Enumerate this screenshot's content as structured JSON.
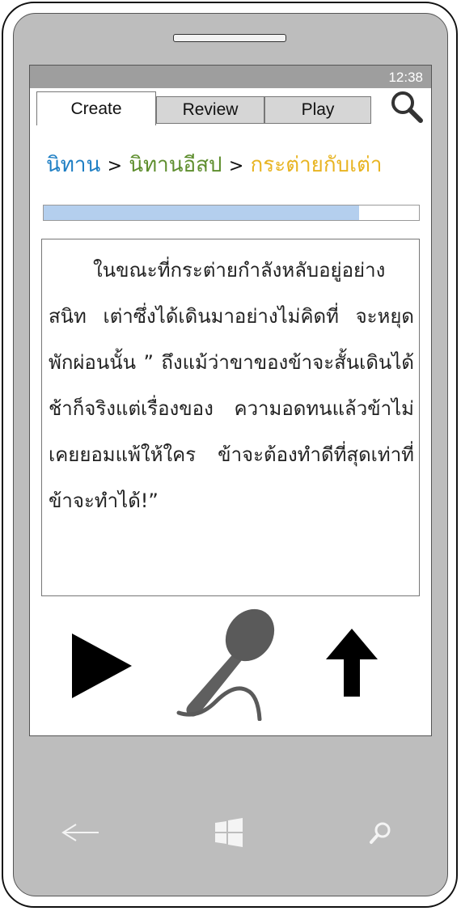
{
  "status": {
    "time": "12:38"
  },
  "tabs": [
    {
      "label": "Create",
      "active": true
    },
    {
      "label": "Review",
      "active": false
    },
    {
      "label": "Play",
      "active": false
    }
  ],
  "breadcrumb": {
    "items": [
      "นิทาน",
      "นิทานอีสป",
      "กระต่ายกับเต่า"
    ],
    "separator": ">",
    "colors": [
      "#1f7fc4",
      "#5e8e2e",
      "#e8b422"
    ]
  },
  "progress": {
    "fraction": 0.84
  },
  "story": {
    "text": "ในขณะที่กระต่ายกำลังหลับอยู่อย่างสนิท เต่าซึ่งได้เดินมาอย่างไม่คิดที่ จะหยุดพักผ่อนนั้น ” ถึงแม้ว่าขาของข้าจะสั้นเดินได้ช้าก็จริงแต่เรื่องของ ความอดทนแล้วข้าไม่เคยยอมแพ้ให้ใคร ข้าจะต้องทำดีที่สุดเท่าที่ข้าจะทำได้!”"
  },
  "controls": {
    "play_icon": "play-icon",
    "mic_icon": "microphone-icon",
    "upload_icon": "arrow-up-icon"
  },
  "nav": {
    "back_icon": "back-arrow-icon",
    "home_icon": "windows-logo-icon",
    "search_icon": "search-icon"
  }
}
